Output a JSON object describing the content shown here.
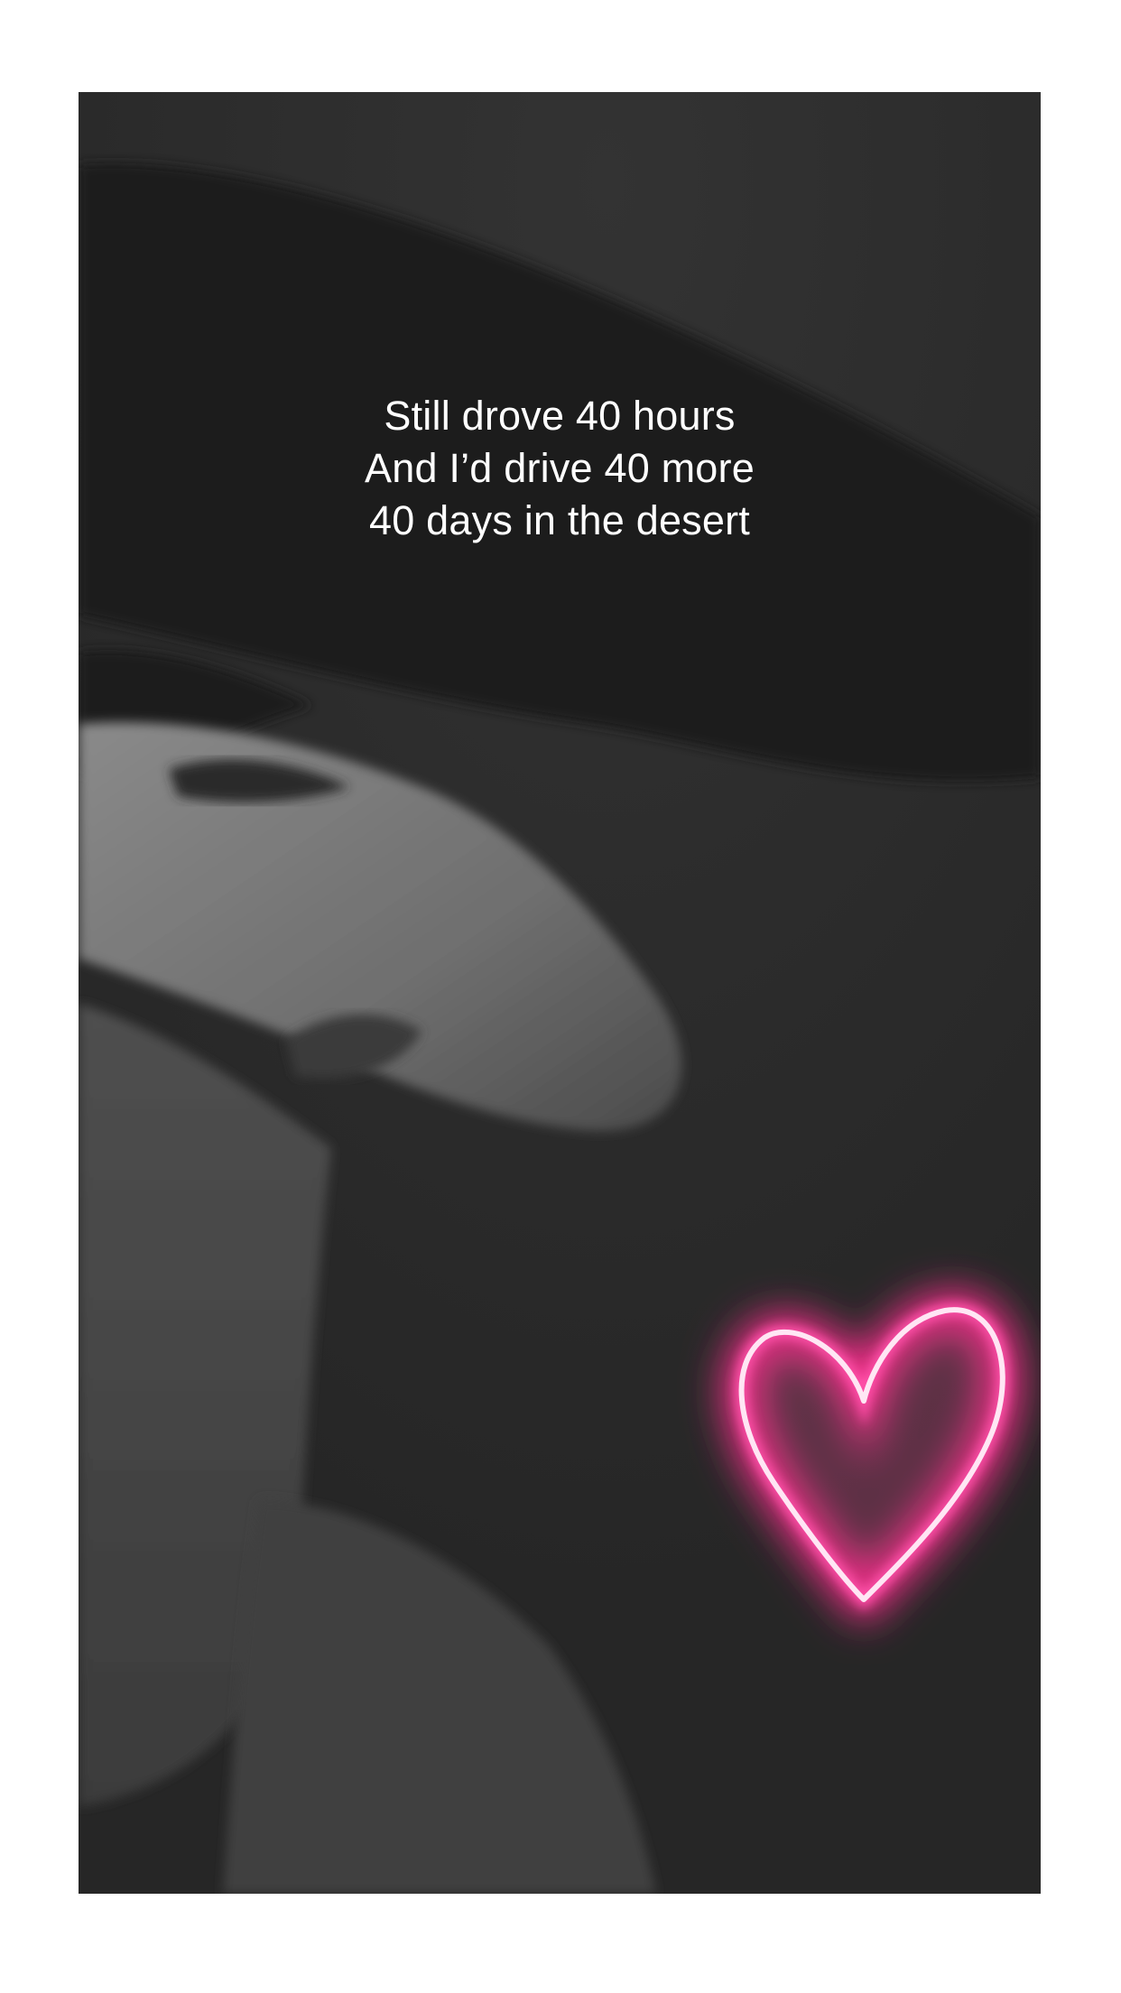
{
  "story": {
    "caption_lines": [
      "Still drove 40 hours",
      "And I’d drive 40 more",
      "40 days in the desert"
    ]
  },
  "sticker": {
    "icon": "neon-heart-icon",
    "color": "#ff4fa8",
    "glow_color": "#ff2d8f",
    "core_color": "#ffe6f4"
  },
  "theme": {
    "background": "#262626",
    "frame_border": "#ffffff",
    "text_color": "#ffffff"
  }
}
